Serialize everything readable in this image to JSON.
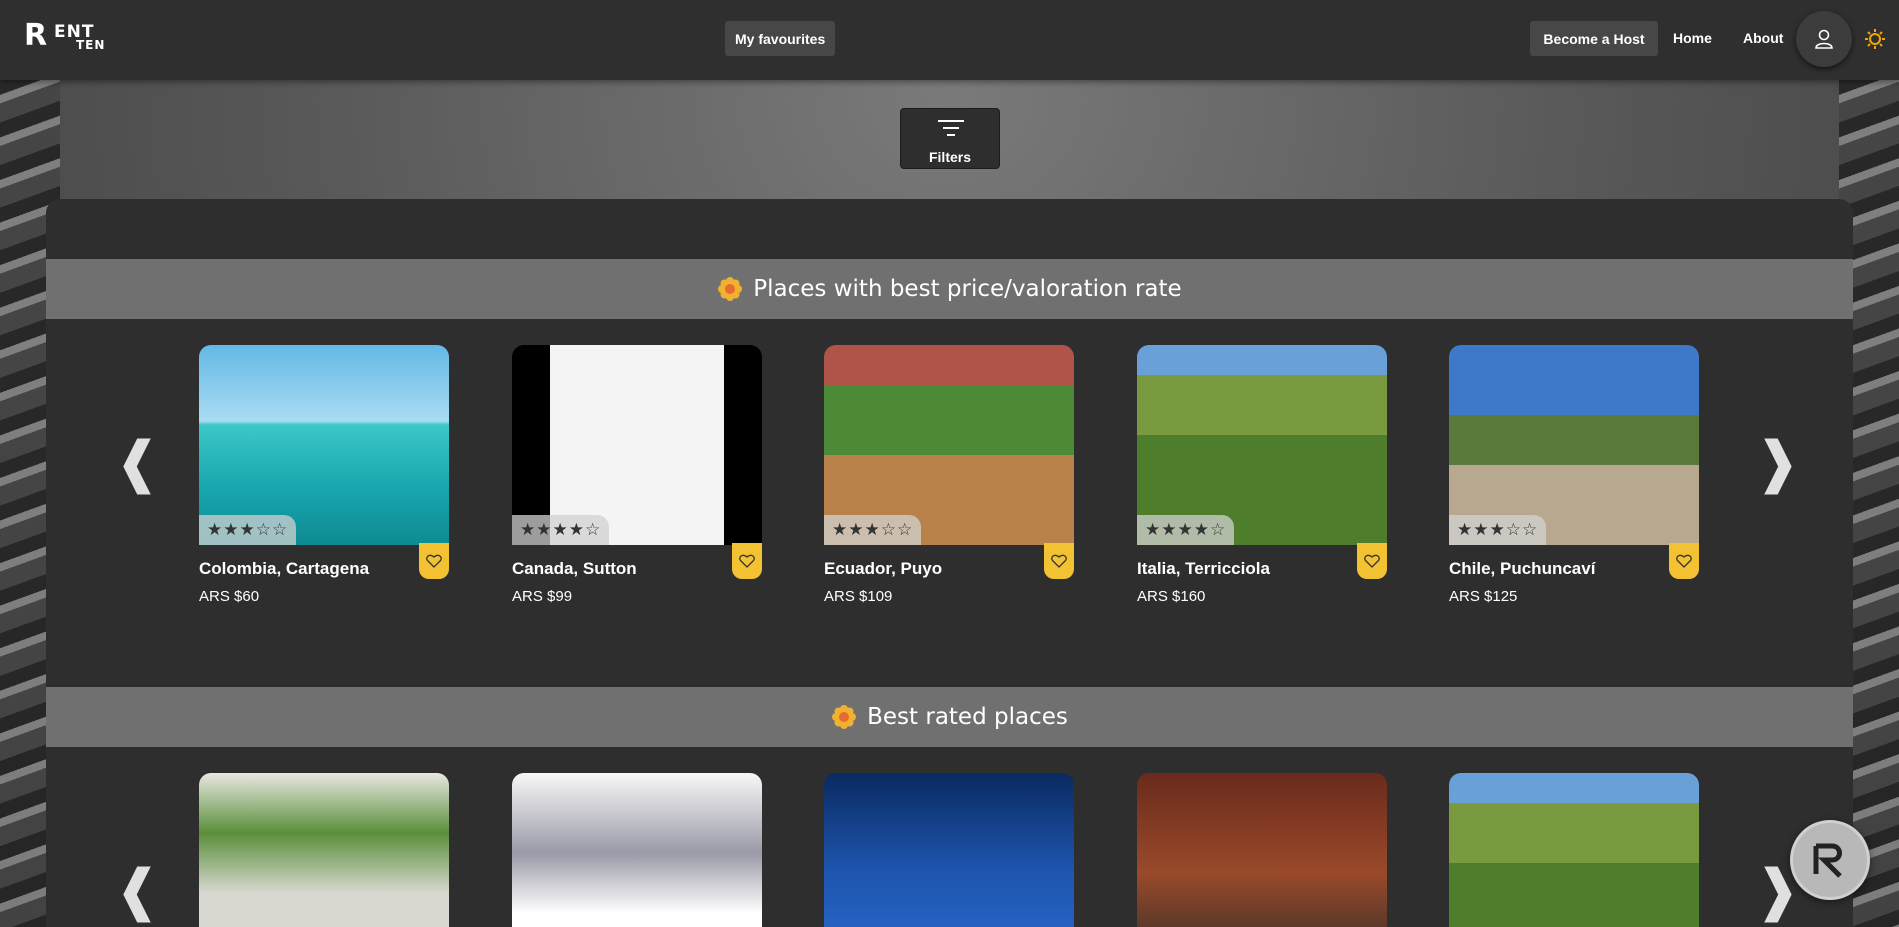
{
  "header": {
    "logo_big": "R",
    "logo_ent": "ENT",
    "logo_ten": "TEN",
    "favourites_label": "My favourites",
    "host_label": "Become a Host",
    "home_label": "Home",
    "about_label": "About",
    "user_icon": "user-icon",
    "theme_icon": "sun-icon"
  },
  "filters": {
    "label": "Filters",
    "icon": "filter-icon"
  },
  "sections": [
    {
      "title": "Places with best price/valoration rate",
      "icon": "flower-icon",
      "cards": [
        {
          "name": "Colombia, Cartagena",
          "price": "ARS $60",
          "rating": 3
        },
        {
          "name": "Canada, Sutton",
          "price": "ARS $99",
          "rating": 4
        },
        {
          "name": "Ecuador, Puyo",
          "price": "ARS $109",
          "rating": 3
        },
        {
          "name": "Italia, Terricciola",
          "price": "ARS $160",
          "rating": 4
        },
        {
          "name": "Chile, Puchuncaví",
          "price": "ARS $125",
          "rating": 3
        }
      ]
    },
    {
      "title": "Best rated places",
      "icon": "flower-icon",
      "cards": []
    }
  ],
  "colors": {
    "header_bg": "#2f2f2f",
    "panel_bg": "#2e2e2e",
    "band_bg": "#707070",
    "favourite_badge": "#f2c232",
    "accent_sun": "#f2a800"
  }
}
